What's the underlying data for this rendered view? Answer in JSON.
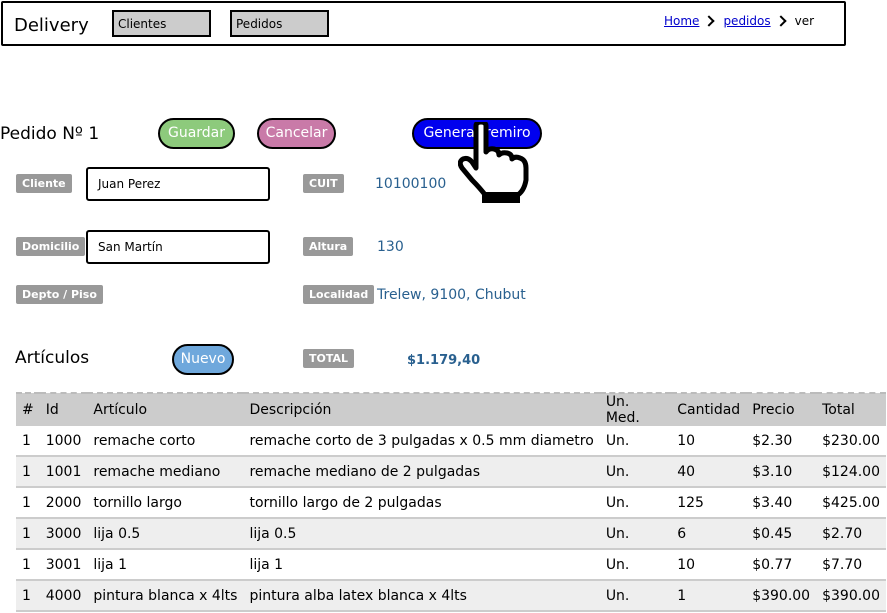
{
  "app": {
    "title": "Delivery"
  },
  "nav": {
    "clientes": "Clientes",
    "pedidos": "Pedidos"
  },
  "breadcrumb": {
    "home": "Home",
    "pedidos": "pedidos",
    "current": "ver"
  },
  "order": {
    "title": "Pedido Nº 1",
    "buttons": {
      "guardar": "Guardar",
      "cancelar": "Cancelar",
      "generar": "Generar remiro"
    }
  },
  "form": {
    "cliente": {
      "label": "Cliente",
      "value": "Juan Perez"
    },
    "cuit": {
      "label": "CUIT",
      "value": "10100100"
    },
    "domicilio": {
      "label": "Domicilio",
      "value": "San Martín"
    },
    "altura": {
      "label": "Altura",
      "value": "130"
    },
    "depto": {
      "label": "Depto / Piso",
      "value": ""
    },
    "localidad": {
      "label": "Localidad",
      "value": "Trelew, 9100, Chubut"
    }
  },
  "articulos": {
    "title": "Artículos",
    "nuevo": "Nuevo",
    "total_label": "TOTAL",
    "total_value": "$1.179,40",
    "columns": [
      "#",
      "Id",
      "Artículo",
      "Descripción",
      "Un. Med.",
      "Cantidad",
      "Precio",
      "Total"
    ],
    "rows": [
      [
        "1",
        "1000",
        "remache corto",
        "remache corto de 3 pulgadas x 0.5 mm diametro",
        "Un.",
        "10",
        "$2.30",
        "$230.00"
      ],
      [
        "1",
        "1001",
        "remache mediano",
        "remache mediano de 2 pulgadas",
        "Un.",
        "40",
        "$3.10",
        "$124.00"
      ],
      [
        "1",
        "2000",
        "tornillo largo",
        "tornillo largo de 2 pulgadas",
        "Un.",
        "125",
        "$3.40",
        "$425.00"
      ],
      [
        "1",
        "3000",
        "lija 0.5",
        "lija 0.5",
        "Un.",
        "6",
        "$0.45",
        "$2.70"
      ],
      [
        "1",
        "3001",
        "lija 1",
        "lija 1",
        "Un.",
        "10",
        "$0.77",
        "$7.70"
      ],
      [
        "1",
        "4000",
        "pintura blanca x 4lts",
        "pintura alba latex blanca x 4lts",
        "Un.",
        "1",
        "$390.00",
        "$390.00"
      ]
    ]
  },
  "icons": {
    "cursor": "hand-pointer-icon"
  }
}
